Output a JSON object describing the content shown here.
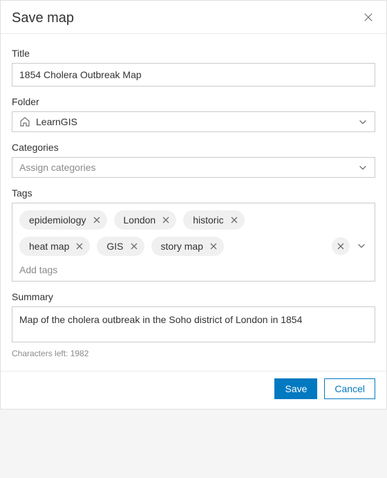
{
  "dialog": {
    "title": "Save map",
    "close_label": "Close"
  },
  "fields": {
    "title": {
      "label": "Title",
      "value": "1854 Cholera Outbreak Map"
    },
    "folder": {
      "label": "Folder",
      "selected": "LearnGIS"
    },
    "categories": {
      "label": "Categories",
      "placeholder": "Assign categories"
    },
    "tags": {
      "label": "Tags",
      "items": [
        {
          "label": "epidemiology"
        },
        {
          "label": "London"
        },
        {
          "label": "historic"
        },
        {
          "label": "heat map"
        },
        {
          "label": "GIS"
        },
        {
          "label": "story map"
        }
      ],
      "add_placeholder": "Add tags"
    },
    "summary": {
      "label": "Summary",
      "value": "Map of the cholera outbreak in the Soho district of London in 1854",
      "chars_left": "Characters left: 1982"
    }
  },
  "footer": {
    "save_label": "Save",
    "cancel_label": "Cancel"
  },
  "colors": {
    "primary": "#0079c1",
    "border": "#cacaca",
    "text": "#323232",
    "muted": "#8a8a8a",
    "chip": "#f0f0f0"
  }
}
